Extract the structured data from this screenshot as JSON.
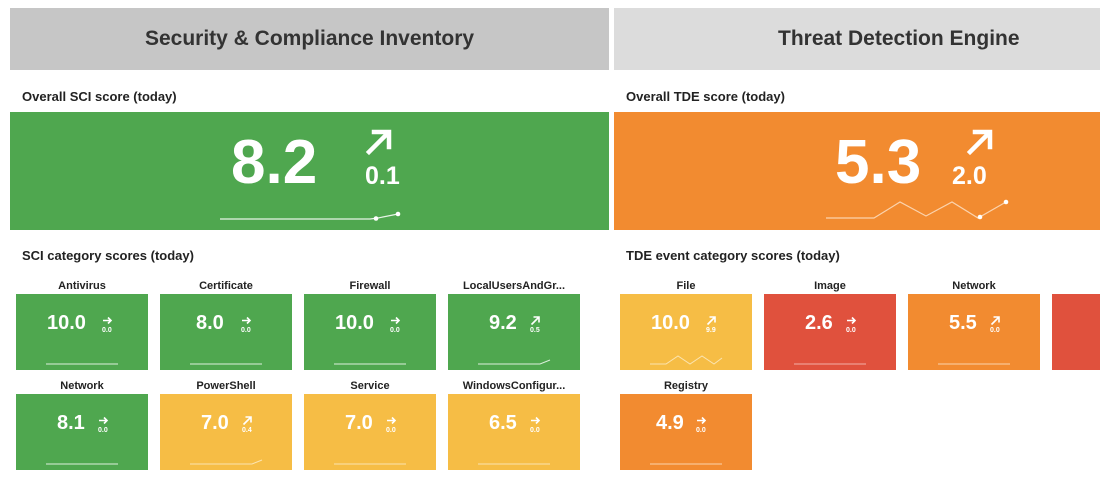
{
  "colors": {
    "green": "#4fa74f",
    "orange": "#f28b30",
    "yellow": "#f6bd45",
    "red": "#e0513d"
  },
  "sci": {
    "title": "Security & Compliance Inventory",
    "overall_label": "Overall SCI score (today)",
    "overall_score": "8.2",
    "overall_delta": "0.1",
    "overall_trend_icon": "arrow-up-right-icon",
    "overall_status": "green",
    "category_label": "SCI category scores (today)",
    "categories": [
      {
        "name": "Antivirus",
        "score": "10.0",
        "delta": "0.0",
        "trend_icon": "arrow-right-icon",
        "status": "green"
      },
      {
        "name": "Certificate",
        "score": "8.0",
        "delta": "0.0",
        "trend_icon": "arrow-right-icon",
        "status": "green"
      },
      {
        "name": "Firewall",
        "score": "10.0",
        "delta": "0.0",
        "trend_icon": "arrow-right-icon",
        "status": "green"
      },
      {
        "name": "LocalUsersAndGr...",
        "score": "9.2",
        "delta": "0.5",
        "trend_icon": "arrow-up-right-icon",
        "status": "green"
      },
      {
        "name": "Network",
        "score": "8.1",
        "delta": "0.0",
        "trend_icon": "arrow-right-icon",
        "status": "green"
      },
      {
        "name": "PowerShell",
        "score": "7.0",
        "delta": "0.4",
        "trend_icon": "arrow-up-right-icon",
        "status": "yellow"
      },
      {
        "name": "Service",
        "score": "7.0",
        "delta": "0.0",
        "trend_icon": "arrow-right-icon",
        "status": "yellow"
      },
      {
        "name": "WindowsConfigur...",
        "score": "6.5",
        "delta": "0.0",
        "trend_icon": "arrow-right-icon",
        "status": "yellow"
      }
    ]
  },
  "tde": {
    "title": "Threat Detection Engine",
    "overall_label": "Overall TDE score (today)",
    "overall_score": "5.3",
    "overall_delta": "2.0",
    "overall_trend_icon": "arrow-up-right-icon",
    "overall_status": "orange",
    "category_label": "TDE event category scores (today)",
    "categories": [
      {
        "name": "File",
        "score": "10.0",
        "delta": "9.9",
        "trend_icon": "arrow-up-right-icon",
        "status": "yellow"
      },
      {
        "name": "Image",
        "score": "2.6",
        "delta": "0.0",
        "trend_icon": "arrow-right-icon",
        "status": "red"
      },
      {
        "name": "Network",
        "score": "5.5",
        "delta": "0.0",
        "trend_icon": "arrow-up-right-icon",
        "status": "orange"
      },
      {
        "name": "",
        "score": "",
        "delta": "",
        "trend_icon": "",
        "status": "red"
      },
      {
        "name": "Registry",
        "score": "4.9",
        "delta": "0.0",
        "trend_icon": "arrow-right-icon",
        "status": "orange"
      }
    ]
  }
}
